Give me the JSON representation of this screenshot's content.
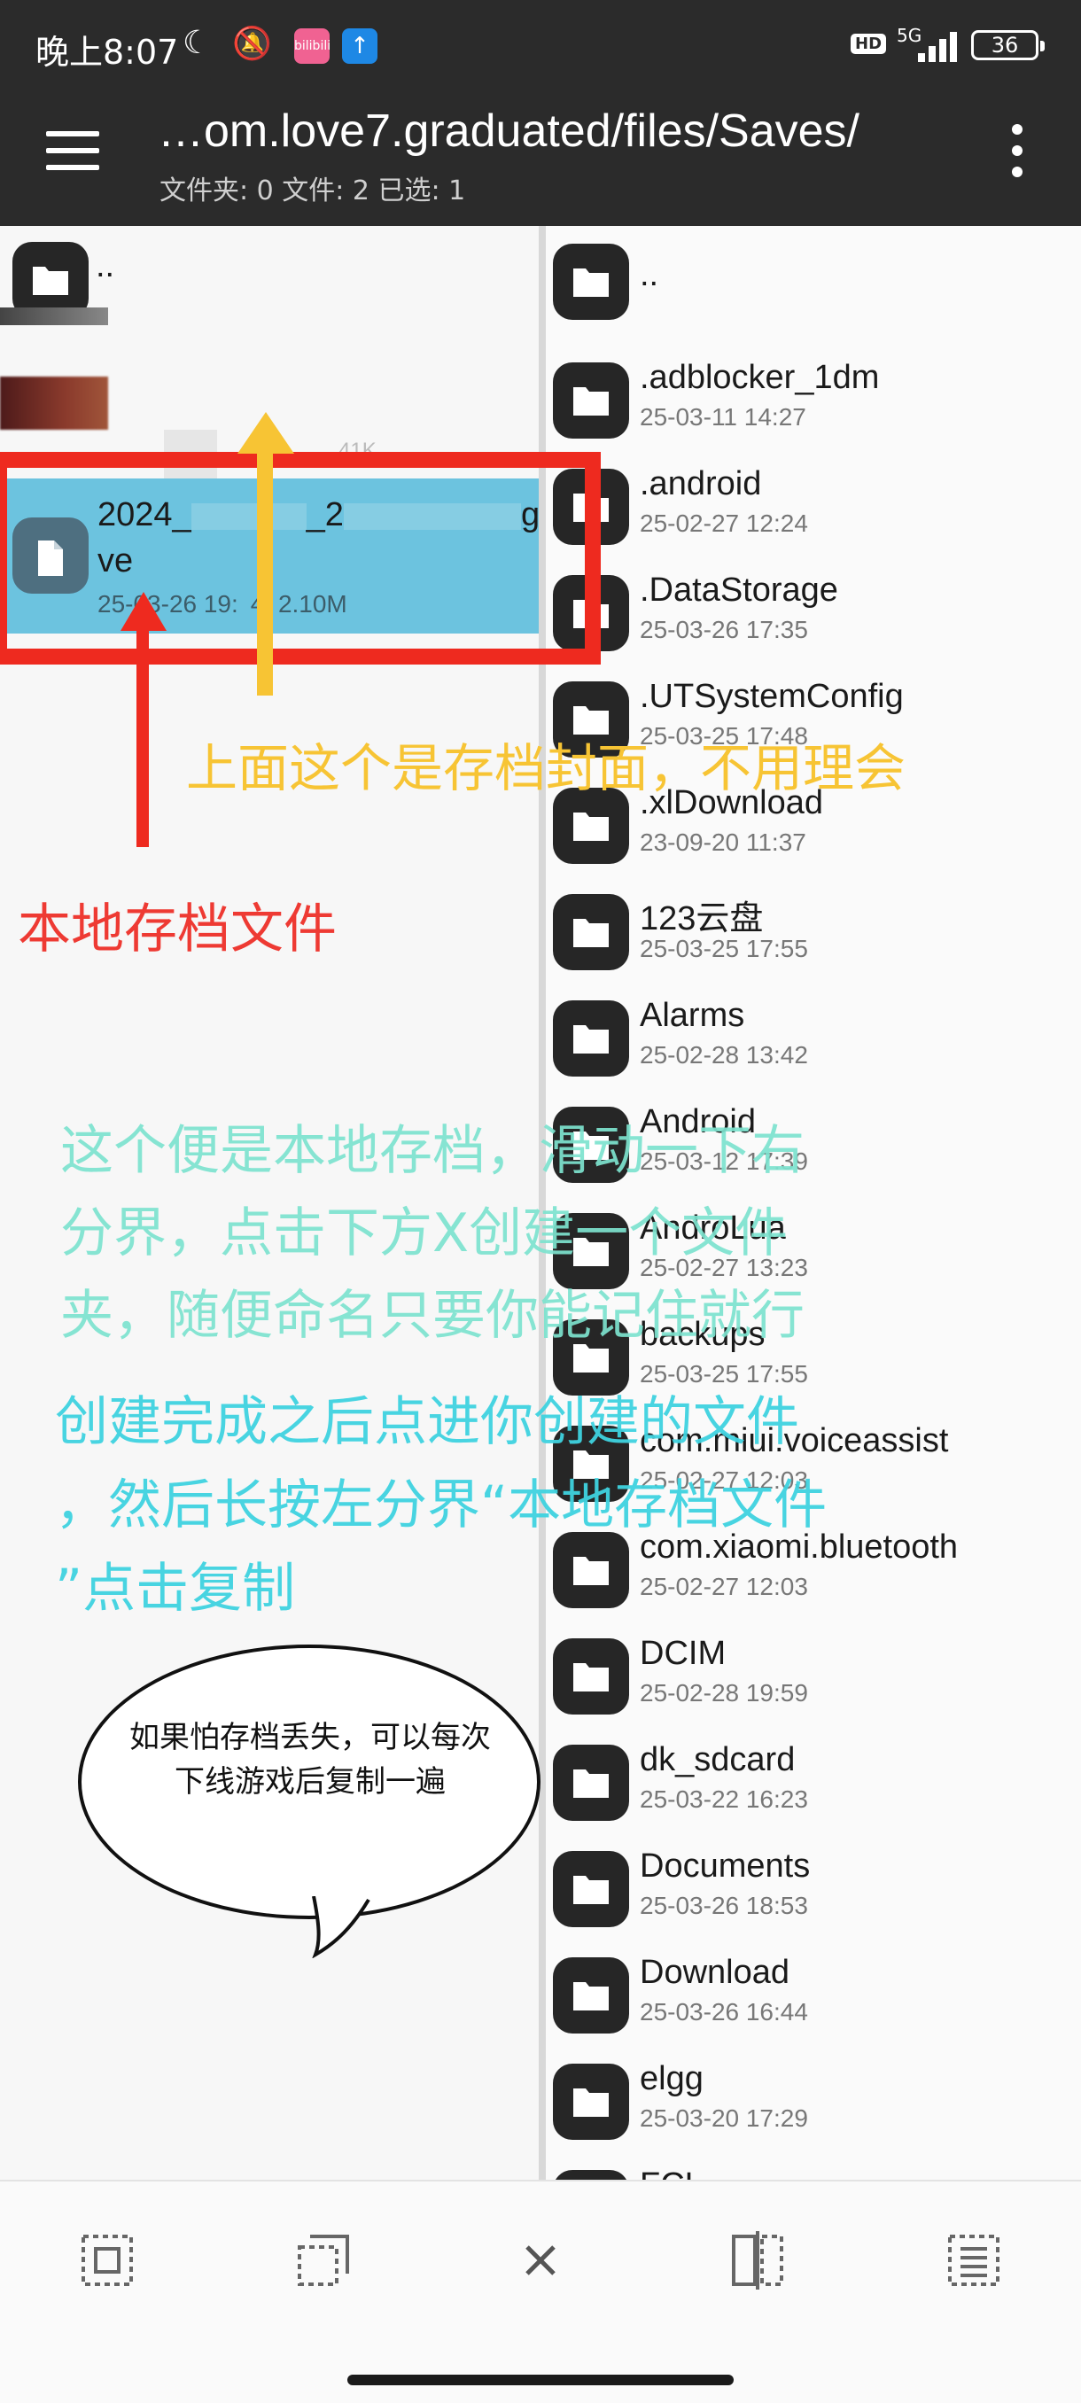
{
  "status_bar": {
    "time": "晚上8:07",
    "icons": [
      "moon-icon",
      "mute-icon",
      "bilibili-app-icon",
      "upload-app-icon"
    ],
    "pink_app_label": "bilibili",
    "hd_label": "HD",
    "network": "5G",
    "battery": "36"
  },
  "app_bar": {
    "path": "…om.love7.graduated/files/Saves/",
    "summary": "文件夹: 0   文件: 2   已选: 1"
  },
  "left_pane": {
    "items": [
      {
        "name": "..",
        "meta": ""
      },
      {
        "name": "",
        "meta": "41K"
      },
      {
        "name_line1": "2024_",
        "name_mid": "_2",
        "name_end": "gsa",
        "name_line2": "ve",
        "meta_date": "25-03-26 19:",
        "meta_mid": "4",
        "meta_size": "2.10M",
        "selected": true
      }
    ]
  },
  "right_pane": {
    "items": [
      {
        "name": "..",
        "date": ""
      },
      {
        "name": ".adblocker_1dm",
        "date": "25-03-11 14:27"
      },
      {
        "name": ".android",
        "date": "25-02-27 12:24"
      },
      {
        "name": ".DataStorage",
        "date": "25-03-26 17:35"
      },
      {
        "name": ".UTSystemConfig",
        "date": "25-03-25 17:48"
      },
      {
        "name": ".xlDownload",
        "date": "23-09-20 11:37"
      },
      {
        "name": "123云盘",
        "date": "25-03-25 17:55"
      },
      {
        "name": "Alarms",
        "date": "25-02-28 13:42"
      },
      {
        "name": "Android",
        "date": "25-03-12 17:39"
      },
      {
        "name": "AndroLua",
        "date": "25-02-27 13:23"
      },
      {
        "name": "backups",
        "date": "25-03-25 17:55"
      },
      {
        "name": "com.miui.voiceassist",
        "date": "25-02-27 12:03"
      },
      {
        "name": "com.xiaomi.bluetooth",
        "date": "25-02-27 12:03"
      },
      {
        "name": "DCIM",
        "date": "25-02-28 19:59"
      },
      {
        "name": "dk_sdcard",
        "date": "25-03-22 16:23"
      },
      {
        "name": "Documents",
        "date": "25-03-26 18:53"
      },
      {
        "name": "Download",
        "date": "25-03-26 16:44"
      },
      {
        "name": "elgg",
        "date": "25-03-20 17:29"
      },
      {
        "name": "FCL",
        "date": ""
      }
    ]
  },
  "annotations": {
    "cover_note": "上面这个是存档封面，不用理会",
    "local_save": "本地存档文件",
    "step1_line1": "这个便是本地存档，滑动一下右",
    "step1_line2": "分界，点击下方X创建一个文件",
    "step1_line3": "夹，随便命名只要你能记住就行",
    "step2_line1": "创建完成之后点进你创建的文件",
    "step2_line2": "，然后长按左分界“本地存档文件",
    "step2_line3": "”点击复制",
    "bubble": "如果怕存档丢失，可以每次下线游戏后复制一遍"
  },
  "colors": {
    "red": "#ee2a1f",
    "yellow": "#f7c434",
    "teal": "#7de3cf",
    "cyan": "#3fd3e0",
    "selected_row": "#6cc3df",
    "appbar": "#2b2b2b"
  },
  "bottom_bar": {
    "buttons": [
      "select-all-icon",
      "select-range-icon",
      "close-icon",
      "split-pane-icon",
      "list-menu-icon"
    ]
  }
}
